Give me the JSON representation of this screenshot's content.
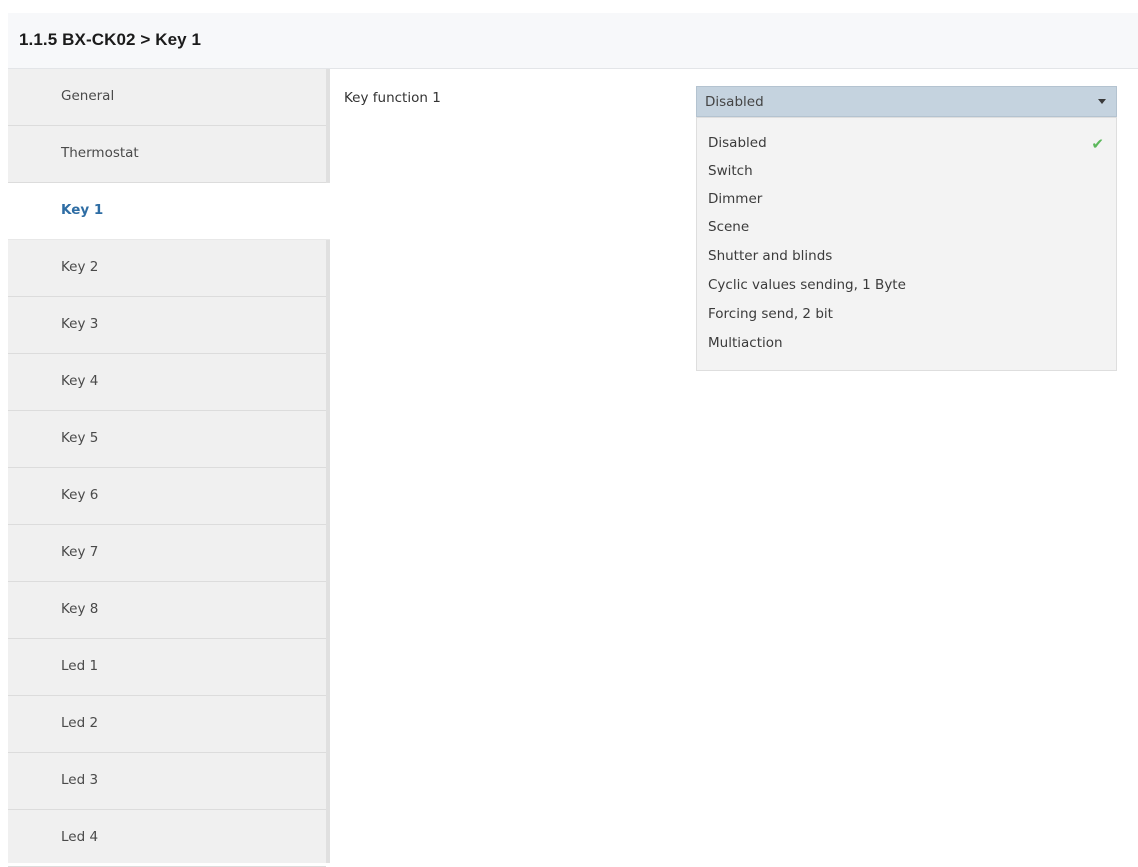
{
  "header": {
    "title": "1.1.5 BX-CK02 > Key 1"
  },
  "sidebar": {
    "items": [
      {
        "label": "General"
      },
      {
        "label": "Thermostat"
      },
      {
        "label": "Key 1",
        "active": true
      },
      {
        "label": "Key 2"
      },
      {
        "label": "Key 3"
      },
      {
        "label": "Key 4"
      },
      {
        "label": "Key 5"
      },
      {
        "label": "Key 6"
      },
      {
        "label": "Key 7"
      },
      {
        "label": "Key 8"
      },
      {
        "label": "Led 1"
      },
      {
        "label": "Led 2"
      },
      {
        "label": "Led 3"
      },
      {
        "label": "Led 4"
      }
    ]
  },
  "main": {
    "param_label": "Key function 1",
    "select": {
      "value": "Disabled",
      "icon": "chevron-down-icon"
    },
    "options": [
      {
        "label": "Disabled",
        "selected": true
      },
      {
        "label": "Switch"
      },
      {
        "label": "Dimmer"
      },
      {
        "label": "Scene"
      },
      {
        "label": "Shutter and blinds"
      },
      {
        "label": "Cyclic values sending, 1 Byte"
      },
      {
        "label": "Forcing send, 2 bit"
      },
      {
        "label": "Multiaction"
      }
    ],
    "check_icon": "✔"
  },
  "colors": {
    "active_nav_text": "#2e6da4",
    "select_background": "#c5d3df",
    "check_color": "#5cb85c"
  }
}
